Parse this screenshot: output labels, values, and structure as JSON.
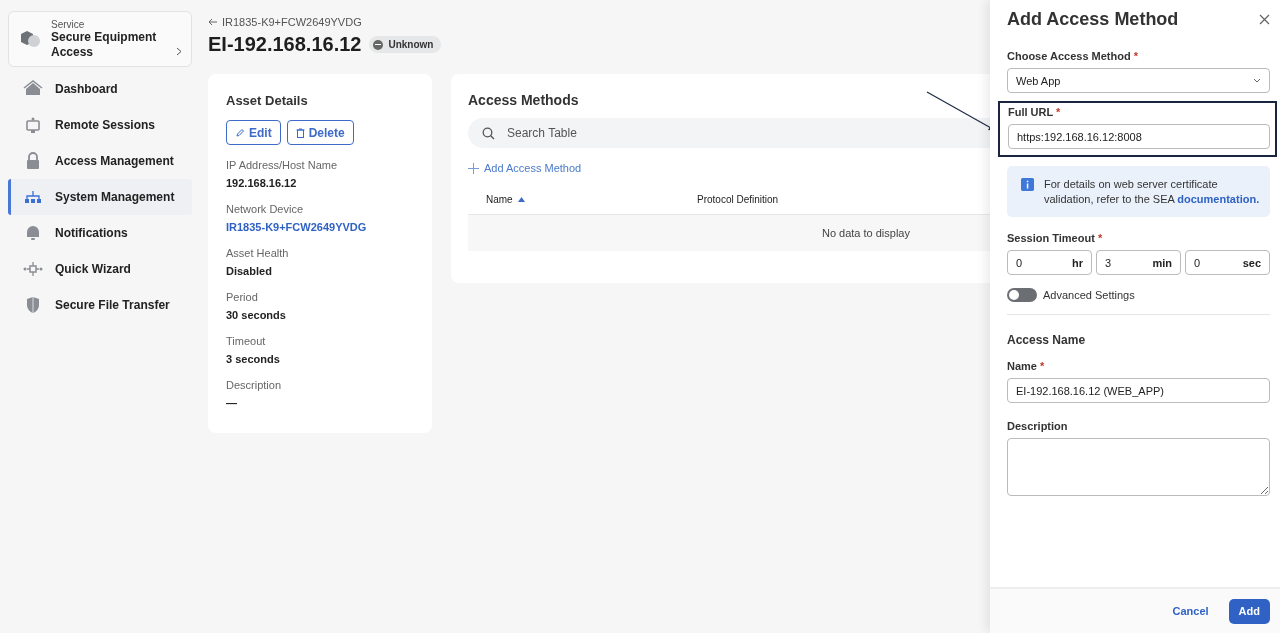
{
  "sidebar": {
    "service": {
      "label": "Service",
      "name": "Secure Equipment Access"
    },
    "items": [
      {
        "label": "Dashboard",
        "selected": false
      },
      {
        "label": "Remote Sessions",
        "selected": false
      },
      {
        "label": "Access Management",
        "selected": false
      },
      {
        "label": "System Management",
        "selected": true
      },
      {
        "label": "Notifications",
        "selected": false
      },
      {
        "label": "Quick Wizard",
        "selected": false
      },
      {
        "label": "Secure File Transfer",
        "selected": false
      }
    ]
  },
  "header": {
    "back_link": "IR1835-K9+FCW2649YVDG",
    "title": "EI-192.168.16.12",
    "status": "Unknown"
  },
  "asset_details": {
    "title": "Asset Details",
    "buttons": [
      {
        "label": "Edit"
      },
      {
        "label": "Delete"
      }
    ],
    "fields": [
      {
        "label": "IP Address/Host Name",
        "value": "192.168.16.12",
        "kind": "text"
      },
      {
        "label": "Network Device",
        "value": "IR1835-K9+FCW2649YVDG",
        "kind": "link"
      },
      {
        "label": "Asset Health",
        "value": "Disabled",
        "kind": "text"
      },
      {
        "label": "Period",
        "value": "30 seconds",
        "kind": "text"
      },
      {
        "label": "Timeout",
        "value": "3 seconds",
        "kind": "text"
      },
      {
        "label": "Description",
        "value": "—",
        "kind": "text"
      }
    ]
  },
  "access_methods": {
    "title": "Access Methods",
    "search": {
      "placeholder": "Search Table"
    },
    "add_link": "Add Access Method",
    "columns": [
      {
        "label": "Name",
        "sorted": true
      },
      {
        "label": "Protocol Definition",
        "sorted": false
      }
    ],
    "empty_text": "No data to display"
  },
  "drawer": {
    "title": "Add Access Method",
    "method": {
      "label": "Choose Access Method",
      "required": "*",
      "value": "Web App"
    },
    "full_url": {
      "label": "Full URL",
      "required": "*",
      "value": "https:192.168.16.12:8008",
      "highlighted": true
    },
    "info": {
      "text": "For details on web server certificate validation, refer to the SEA",
      "link": "documentation."
    },
    "session_timeout": {
      "label": "Session Timeout",
      "required": "*",
      "fields": [
        {
          "value": "0",
          "unit": "hr"
        },
        {
          "value": "3",
          "unit": "min"
        },
        {
          "value": "0",
          "unit": "sec"
        }
      ]
    },
    "advanced": {
      "label": "Advanced Settings",
      "on": false
    },
    "access_name": {
      "title": "Access Name",
      "name": {
        "label": "Name",
        "required": "*",
        "value": "EI-192.168.16.12 (WEB_APP)"
      },
      "description": {
        "label": "Description"
      }
    },
    "buttons": [
      {
        "label": "Cancel",
        "kind": "secondary"
      },
      {
        "label": "Add",
        "kind": "primary"
      }
    ]
  }
}
